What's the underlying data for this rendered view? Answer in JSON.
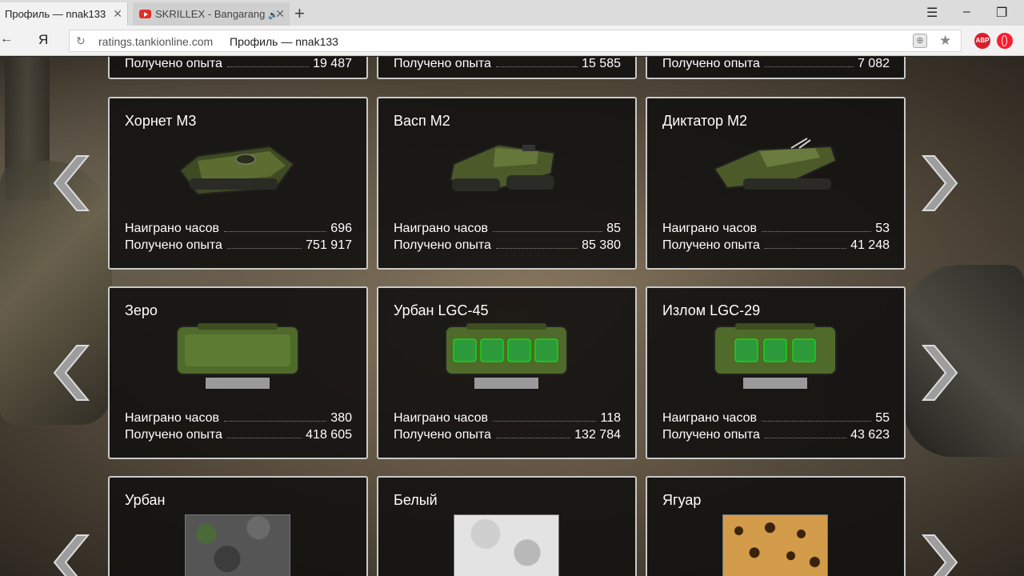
{
  "browser": {
    "active_tab": "Профиль — nnak133",
    "inactive_tab": "SKRILLEX - Bangarang",
    "address_url": "ratings.tankionline.com",
    "address_title": "Профиль — nnak133",
    "yandex_letter": "Я",
    "abp_label": "ABP"
  },
  "labels": {
    "hours": "Наиграно часов",
    "exp": "Получено опыта"
  },
  "partial_row": [
    {
      "exp": "19 487"
    },
    {
      "exp": "15 585"
    },
    {
      "exp": "7 082"
    }
  ],
  "hulls": [
    {
      "name": "Хорнет M3",
      "hours": "696",
      "exp": "751 917"
    },
    {
      "name": "Васп M2",
      "hours": "85",
      "exp": "85 380"
    },
    {
      "name": "Диктатор M2",
      "hours": "53",
      "exp": "41 248"
    }
  ],
  "modules": [
    {
      "name": "Зеро",
      "hours": "380",
      "exp": "418 605"
    },
    {
      "name": "Урбан LGC-45",
      "hours": "118",
      "exp": "132 784"
    },
    {
      "name": "Излом LGC-29",
      "hours": "55",
      "exp": "43 623"
    }
  ],
  "paints": [
    {
      "name": "Урбан"
    },
    {
      "name": "Белый"
    },
    {
      "name": "Ягуар"
    }
  ],
  "colors": {
    "card_bg": "#141210",
    "card_border": "#c9c9c9",
    "module_green": "#4f7a2a",
    "tank_green": "#4c5a2a"
  }
}
